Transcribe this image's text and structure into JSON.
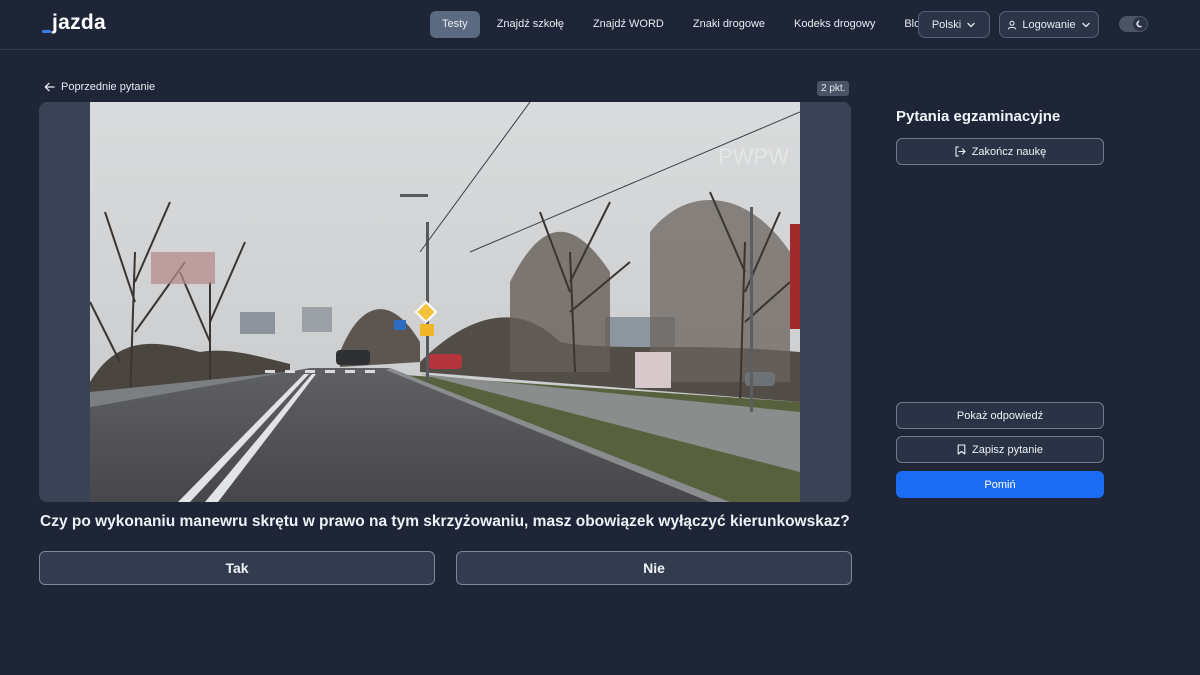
{
  "brand": {
    "name": "jazda",
    "accent": "#3d7bf0"
  },
  "nav": {
    "items": [
      {
        "label": "Testy",
        "active": true
      },
      {
        "label": "Znajdź szkołę",
        "active": false
      },
      {
        "label": "Znajdź WORD",
        "active": false
      },
      {
        "label": "Znaki drogowe",
        "active": false
      },
      {
        "label": "Kodeks drogowy",
        "active": false
      },
      {
        "label": "Blog",
        "active": false
      }
    ],
    "language": "Polski",
    "login": "Logowanie",
    "theme_toggle_icon": "moon-icon"
  },
  "question": {
    "back_label": "Poprzednie pytanie",
    "points": "2 pkt.",
    "image_watermark": "PWPW",
    "text": "Czy po wykonaniu manewru skrętu w prawo na tym skrzyżowaniu, masz obowiązek wyłączyć kierunkowskaz?",
    "answers": [
      "Tak",
      "Nie"
    ]
  },
  "sidebar": {
    "title": "Pytania egzaminacyjne",
    "end_label": "Zakończ naukę",
    "show_answer_label": "Pokaż odpowiedź",
    "save_label": "Zapisz pytanie",
    "skip_label": "Pomiń"
  },
  "colors": {
    "background": "#1d2536",
    "primary_button": "#1b6cf2",
    "active_tab": "#5b6a80"
  }
}
